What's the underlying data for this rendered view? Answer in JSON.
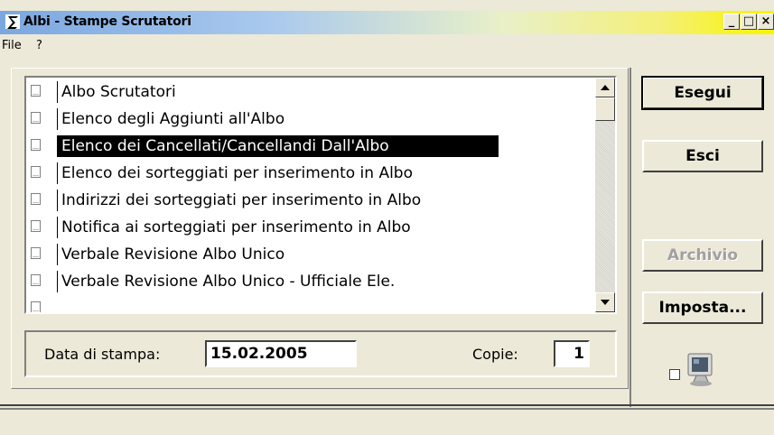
{
  "window": {
    "title": "Albi - Stampe Scrutatori",
    "controls": {
      "minimize": "_",
      "maximize": "□",
      "close": "×"
    }
  },
  "menu": [
    "File",
    "?"
  ],
  "reports": {
    "items": [
      {
        "label": "Albo Scrutatori",
        "selected": false
      },
      {
        "label": "Elenco degli Aggiunti all'Albo",
        "selected": false
      },
      {
        "label": "Elenco dei Cancellati/Cancellandi Dall'Albo",
        "selected": true
      },
      {
        "label": "Elenco dei sorteggiati per inserimento in Albo",
        "selected": false
      },
      {
        "label": "Indirizzi dei sorteggiati per inserimento in Albo",
        "selected": false
      },
      {
        "label": "Notifica ai sorteggiati per inserimento in Albo",
        "selected": false
      },
      {
        "label": "Verbale Revisione Albo Unico",
        "selected": false
      },
      {
        "label": "Verbale Revisione Albo Unico - Ufficiale Ele.",
        "selected": false
      }
    ]
  },
  "print_options": {
    "date_label": "Data di stampa:",
    "date_value": "15.02.2005",
    "copies_label": "Copie:",
    "copies_value": "1"
  },
  "buttons": {
    "run": "Esegui",
    "exit": "Esci",
    "archive": "Archivio",
    "setup": "Imposta..."
  },
  "colors": {
    "window_bg": "#ece9d8",
    "selection_bg": "#000000",
    "selection_fg": "#ffffff"
  }
}
